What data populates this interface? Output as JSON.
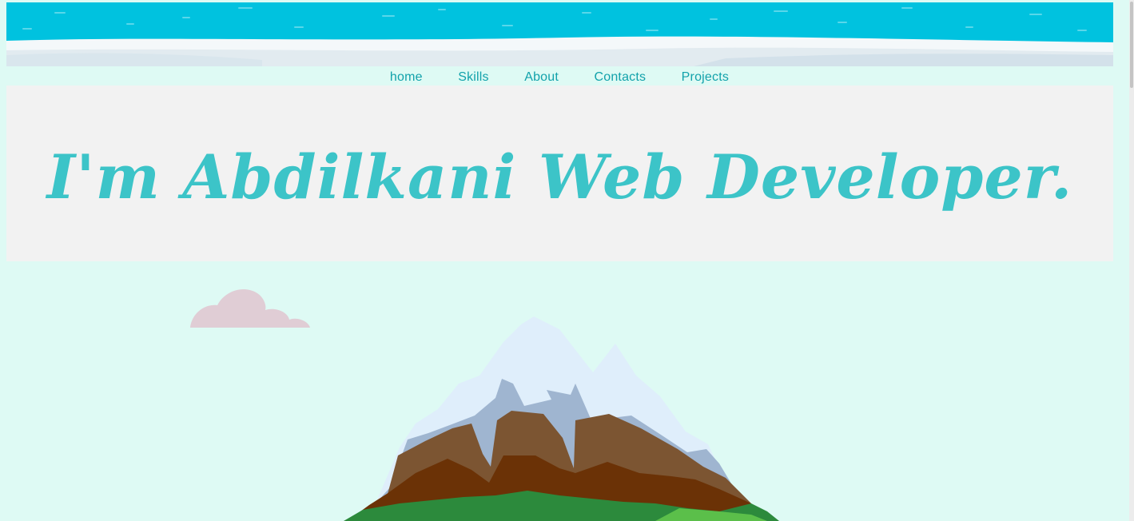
{
  "nav": {
    "items": [
      {
        "label": "home"
      },
      {
        "label": "Skills"
      },
      {
        "label": "About"
      },
      {
        "label": "Contacts"
      },
      {
        "label": "Projects"
      }
    ]
  },
  "hero": {
    "title": "I'm Abdilkani Web Developer."
  },
  "colors": {
    "background": "#defaf4",
    "nav_text": "#12a2ab",
    "hero_bg": "#f2f2f2",
    "title": "#3cc4c8",
    "water": "#00c2df"
  },
  "icons": {
    "banner": "water-wave-banner",
    "cloud": "cloud-icon",
    "mountain": "mountain-illustration"
  }
}
